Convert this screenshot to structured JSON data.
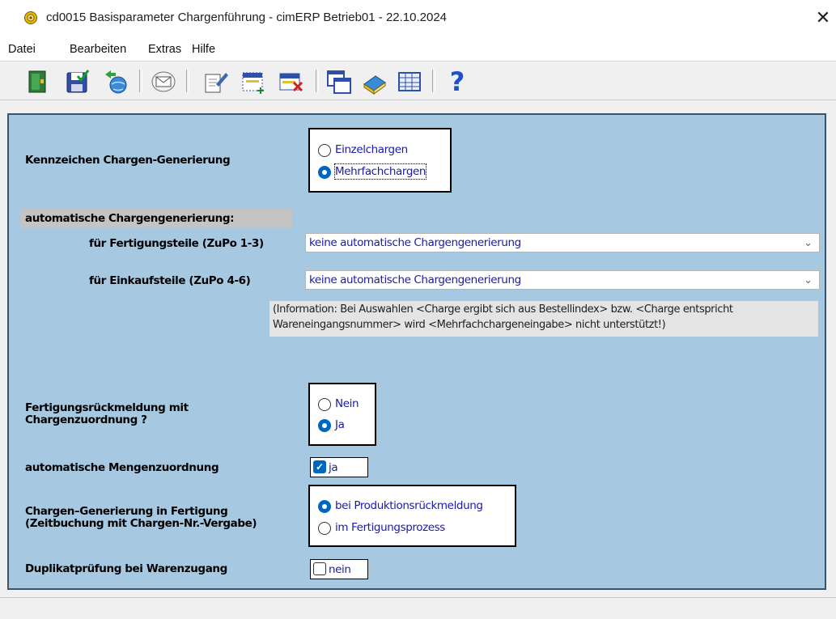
{
  "window": {
    "title": "cd0015 Basisparameter Chargenführung - cimERP  Betrieb01 - 22.10.2024",
    "close_symbol": "✕"
  },
  "menu": {
    "items": [
      "Datei",
      "Bearbeiten",
      "Extras",
      "Hilfe"
    ]
  },
  "toolbar": {
    "help_glyph": "?",
    "buttons": [
      "exit-icon",
      "save-icon",
      "globe-transfer-icon",
      "mail-icon",
      "edit-icon",
      "new-entry-icon",
      "delete-entry-icon",
      "copy-windows-icon",
      "book-icon",
      "table-grid-icon",
      "help-icon"
    ]
  },
  "form": {
    "kennzeichen": {
      "label": "Kennzeichen Chargen-Generierung",
      "options": [
        "Einzelchargen",
        "Mehrfachchargen"
      ],
      "selected": "Mehrfachchargen"
    },
    "auto": {
      "heading": "automatische Chargengenerierung:",
      "fertigung_label": "für Fertigungsteile (ZuPo 1-3)",
      "fertigung_value": "keine automatische Chargengenerierung",
      "einkauf_label": "für Einkaufsteile (ZuPo 4-6)",
      "einkauf_value": "keine automatische Chargengenerierung",
      "info_line1": "(Information: Bei Auswahlen <Charge ergibt sich aus Bestellindex> bzw. <Charge entspricht",
      "info_line2": "Wareneingangsnummer> wird <Mehrfachchargeneingabe> nicht unterstützt!)"
    },
    "rueckmeldung": {
      "label_line1": "Fertigungsrückmeldung mit",
      "label_line2": "Chargenzuordnung ?",
      "options": [
        "Nein",
        "Ja"
      ],
      "selected": "Ja"
    },
    "mengen": {
      "label": "automatische Mengenzuordnung",
      "checkbox_label": "ja",
      "checked": true
    },
    "generierung_fertigung": {
      "label_line1": "Chargen–Generierung in Fertigung",
      "label_line2": "(Zeitbuchung mit Chargen-Nr.-Vergabe)",
      "options": [
        "bei Produktionsrückmeldung",
        "im Fertigungsprozess"
      ],
      "selected": "bei Produktionsrückmeldung"
    },
    "duplikat": {
      "label": "Duplikatprüfung bei Warenzugang",
      "checkbox_label": "nein",
      "checked": false
    }
  },
  "colors": {
    "panel": "#a6c8e0",
    "option_text": "#1a1aa8",
    "radio_selected": "#0067c0"
  }
}
